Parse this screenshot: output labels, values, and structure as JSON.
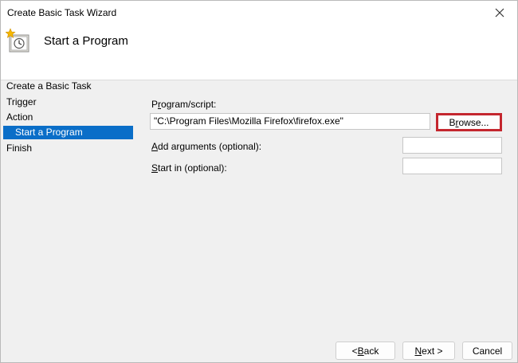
{
  "window": {
    "title": "Create Basic Task Wizard",
    "close_icon": "close-icon"
  },
  "header": {
    "title": "Start a Program",
    "icon": "task-scheduler-icon"
  },
  "steps": {
    "create_basic_task": "Create a Basic Task",
    "trigger": "Trigger",
    "action": "Action",
    "start_program": "Start a Program",
    "finish": "Finish"
  },
  "form": {
    "program_label_pre": "P",
    "program_label_u": "r",
    "program_label_post": "ogram/script:",
    "program_value": "\"C:\\Program Files\\Mozilla Firefox\\firefox.exe\"",
    "browse_pre": "B",
    "browse_u": "r",
    "browse_post": "owse...",
    "args_label_u": "A",
    "args_label_post": "dd arguments (optional):",
    "args_value": "",
    "startin_label_u": "S",
    "startin_label_post": "tart in (optional):",
    "startin_value": ""
  },
  "footer": {
    "back_pre": "< ",
    "back_u": "B",
    "back_post": "ack",
    "next_u": "N",
    "next_post": "ext >",
    "cancel": "Cancel"
  },
  "colors": {
    "selected_step": "#0a6ec8",
    "highlight": "#c4262e"
  }
}
